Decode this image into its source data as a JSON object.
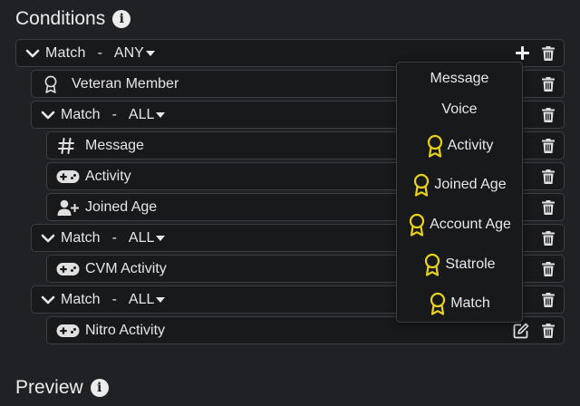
{
  "conditions": {
    "title": "Conditions",
    "root": {
      "label": "Match",
      "separator": "-",
      "mode": "ANY"
    },
    "rows": [
      {
        "label": "Veteran Member",
        "icon": "award-outline-icon"
      },
      {
        "label": "Match",
        "separator": "-",
        "mode": "ALL"
      },
      {
        "label": "Message",
        "icon": "hash-icon"
      },
      {
        "label": "Activity",
        "icon": "gamepad-icon"
      },
      {
        "label": "Joined Age",
        "icon": "user-plus-icon"
      },
      {
        "label": "Match",
        "separator": "-",
        "mode": "ALL"
      },
      {
        "label": "CVM Activity",
        "icon": "gamepad-icon"
      },
      {
        "label": "Match",
        "separator": "-",
        "mode": "ALL"
      },
      {
        "label": "Nitro Activity",
        "icon": "gamepad-icon"
      }
    ]
  },
  "add_menu": {
    "items": [
      {
        "label": "Message"
      },
      {
        "label": "Voice"
      },
      {
        "label": "Activity",
        "icon": "award-icon"
      },
      {
        "label": "Joined Age",
        "icon": "award-icon"
      },
      {
        "label": "Account Age",
        "icon": "award-icon"
      },
      {
        "label": "Statrole",
        "icon": "award-icon"
      },
      {
        "label": "Match",
        "icon": "award-icon"
      }
    ],
    "icon_color": "#e8d21a"
  },
  "preview": {
    "title": "Preview"
  }
}
